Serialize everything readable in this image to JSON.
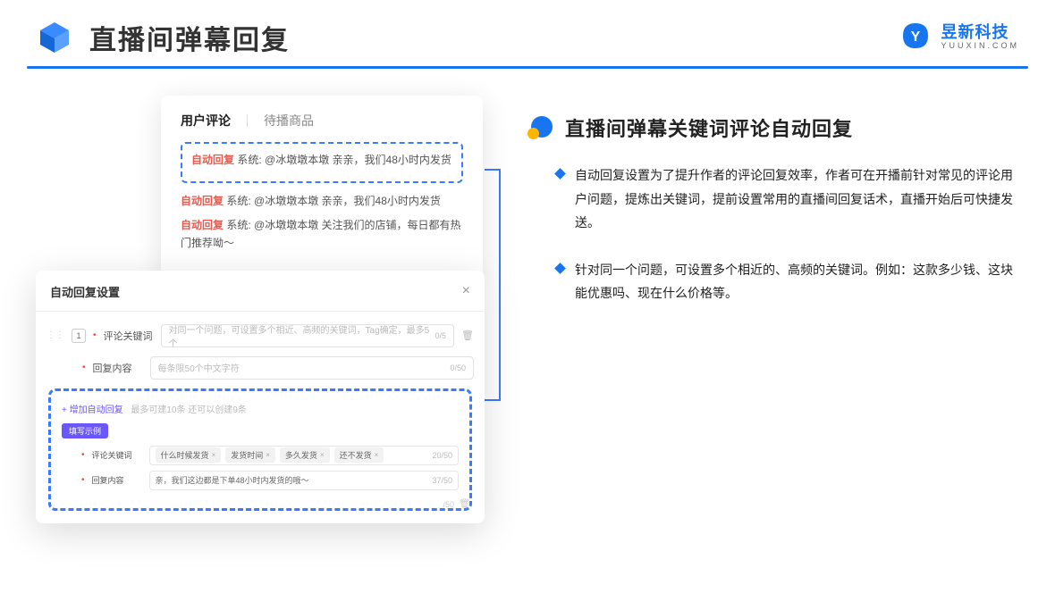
{
  "header": {
    "title": "直播间弹幕回复",
    "brand_cn": "昱新科技",
    "brand_en": "YUUXIN.COM"
  },
  "comments": {
    "tabs": [
      "用户评论",
      "待播商品"
    ],
    "items": [
      {
        "label": "自动回复",
        "text": "系统: @冰墩墩本墩 亲亲，我们48小时内发货"
      },
      {
        "label": "自动回复",
        "text": "系统: @冰墩墩本墩 亲亲，我们48小时内发货"
      },
      {
        "label": "自动回复",
        "text": "系统: @冰墩墩本墩 关注我们的店铺，每日都有热门推荐呦～"
      }
    ]
  },
  "settings": {
    "title": "自动回复设置",
    "index": "1",
    "kw_label": "评论关键词",
    "kw_placeholder": "对同一个问题，可设置多个相近、高频的关键词，Tag确定，最多5个",
    "kw_counter": "0/5",
    "rc_label": "回复内容",
    "rc_placeholder": "每条限50个中文字符",
    "rc_counter": "0/50",
    "add_label": "+ 增加自动回复",
    "add_hint": "最多可建10条 还可以创建9条",
    "example_badge": "填写示例",
    "ex_kw_label": "评论关键词",
    "ex_tags": [
      "什么时候发货",
      "发货时间",
      "多久发货",
      "还不发货"
    ],
    "ex_kw_counter": "20/50",
    "ex_rc_label": "回复内容",
    "ex_rc_text": "亲，我们这边都是下单48小时内发货的哦～",
    "ex_rc_counter": "37/50",
    "lower_counter": "/50"
  },
  "right": {
    "title": "直播间弹幕关键词评论自动回复",
    "points": [
      "自动回复设置为了提升作者的评论回复效率，作者可在开播前针对常见的评论用户问题，提炼出关键词，提前设置常用的直播间回复话术，直播开始后可快捷发送。",
      "针对同一个问题，可设置多个相近的、高频的关键词。例如：这款多少钱、这块能优惠吗、现在什么价格等。"
    ]
  }
}
